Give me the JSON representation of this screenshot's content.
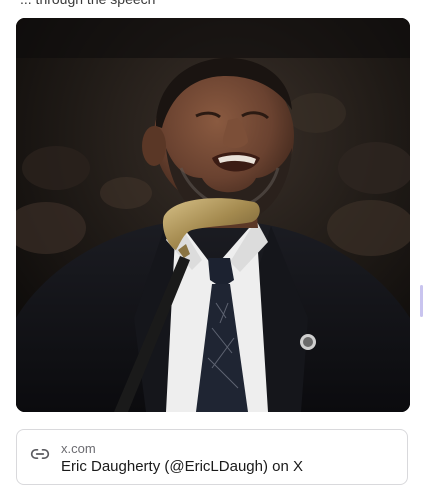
{
  "post": {
    "top_text": "... through the speech"
  },
  "link_card": {
    "domain": "x.com",
    "title": "Eric Daugherty (@EricLDaugh) on X",
    "icon": "link-icon"
  },
  "colors": {
    "card_border": "#d9d9dc",
    "domain_text": "#6b6b70",
    "title_text": "#1a1a1a",
    "scrollbar_thumb": "#c9c4ef"
  }
}
